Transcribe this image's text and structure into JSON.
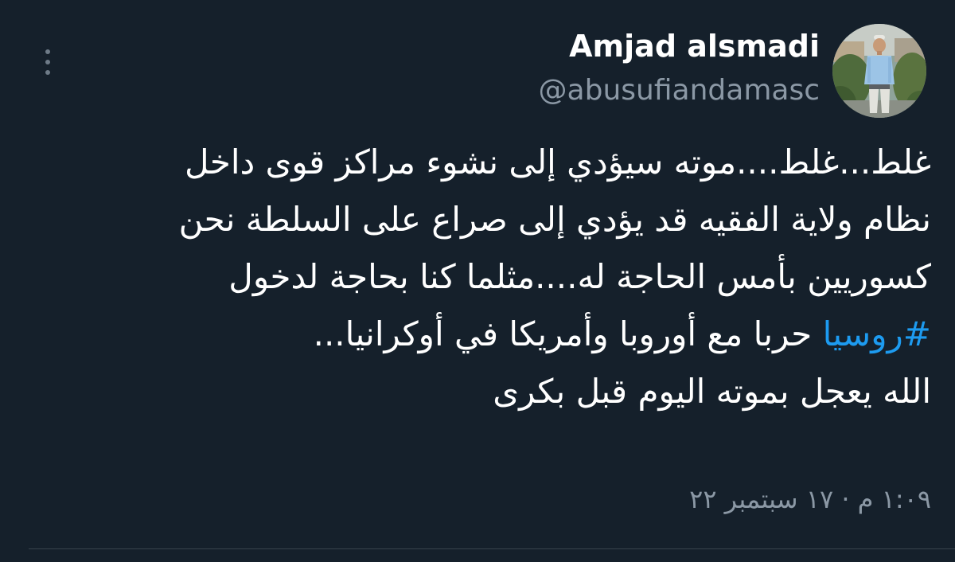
{
  "tweet": {
    "author": {
      "display_name": "Amjad alsmadi",
      "handle": "@abusufiandamasc",
      "avatar_icon": "person-photo-avatar"
    },
    "more_icon": "more-vertical-icon",
    "body": {
      "line1": "غلط...غلط....موته سيؤدي إلى نشوء مراكز قوى داخل",
      "line2": "نظام ولاية الفقيه قد يؤدي إلى صراع على السلطة نحن",
      "line3": "كسوريين بأمس الحاجة له....مثلما كنا بحاجة لدخول",
      "hashtag": "#روسيا",
      "line4_rest": " حربا مع أوروبا وأمريكا في أوكرانيا...",
      "line5": "الله يعجل بموته اليوم قبل بكرى"
    },
    "timestamp": "١:٠٩ م · ١٧ سبتمبر ٢٢",
    "colors": {
      "background": "#15202b",
      "text": "#ffffff",
      "secondary": "#8b98a5",
      "link": "#1d9bf0",
      "divider": "#38444d"
    }
  }
}
